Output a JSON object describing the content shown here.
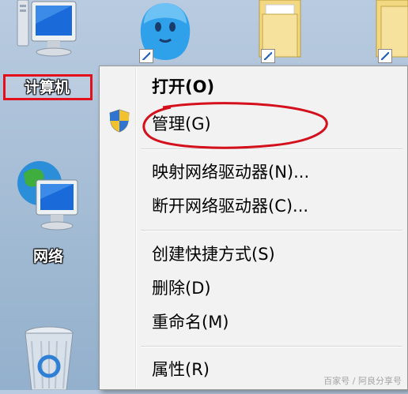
{
  "desktop": {
    "icons": [
      {
        "label": "计算机",
        "icon": "computer-icon"
      },
      {
        "label": "网络",
        "icon": "network-icon"
      },
      {
        "label": "",
        "icon": "recycle-bin-icon"
      },
      {
        "label": "",
        "icon": "qq-icon"
      },
      {
        "label": "",
        "icon": "folder-icon"
      },
      {
        "label": "",
        "icon": "folder-icon"
      }
    ]
  },
  "context_menu": {
    "items": [
      {
        "label": "打开(O)",
        "bold": true
      },
      {
        "label": "管理(G)",
        "icon": "shield-icon",
        "highlighted_by": "red-ellipse"
      },
      {
        "label": "映射网络驱动器(N)..."
      },
      {
        "label": "断开网络驱动器(C)..."
      },
      {
        "label": "创建快捷方式(S)"
      },
      {
        "label": "删除(D)"
      },
      {
        "label": "重命名(M)"
      },
      {
        "label": "属性(R)"
      }
    ]
  },
  "annotation_color": "#d4101c",
  "watermark": "百家号 / 阿良分享号"
}
